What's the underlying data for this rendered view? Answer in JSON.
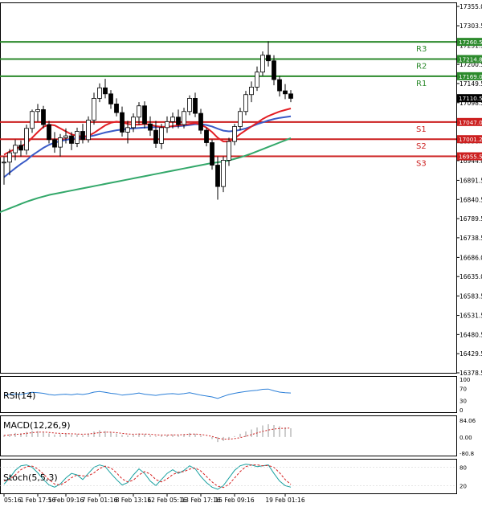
{
  "colors": {
    "bull": "#2e8b2e",
    "bear": "#cc1f1f",
    "ma_fast": "#e31e24",
    "ma_mid": "#3a5bc7",
    "ma_slow": "#33a86a",
    "resistance": "#2c8a2c",
    "support": "#cc1f1f",
    "current_price_bg": "#000000",
    "rsi": "#2b7fd8",
    "macd_signal": "#cc1f1f",
    "macd_hist": "#999999",
    "stoch_k": "#1aa1a1",
    "stoch_d": "#d62020"
  },
  "chart_data": {
    "type": "candlestick",
    "title": "",
    "price_axis": {
      "ticks": [
        "17355.0",
        "17303.5",
        "17251.5",
        "17200.5",
        "17149.5",
        "17098.5",
        "17047.0",
        "16996.0",
        "16944.0",
        "16891.5",
        "16840.5",
        "16789.5",
        "16738.5",
        "16686.0",
        "16635.0",
        "16583.5",
        "16531.5",
        "16480.5",
        "16429.5",
        "16378.5"
      ],
      "ylim": [
        16378.5,
        17355.0
      ]
    },
    "time_axis": {
      "ticks": [
        "05:16",
        "1 Feb 17:16",
        "5 Feb 09:16",
        "7 Feb 01:16",
        "8 Feb 13:16",
        "12 Feb 05:16",
        "13 Feb 17:16",
        "15 Feb 09:16",
        "19 Feb 01:16"
      ]
    },
    "levels": [
      {
        "name": "R3",
        "value": 17260.5,
        "label": "17260.5",
        "kind": "resistance"
      },
      {
        "name": "R2",
        "value": 17214.8,
        "label": "17214.8",
        "kind": "resistance"
      },
      {
        "name": "R1",
        "value": 17169.0,
        "label": "17169.0",
        "kind": "resistance"
      },
      {
        "name": "S1",
        "value": 17047.0,
        "label": "17047.0",
        "kind": "support"
      },
      {
        "name": "S2",
        "value": 17001.2,
        "label": "17001.2",
        "kind": "support"
      },
      {
        "name": "S3",
        "value": 16955.5,
        "label": "16955.5",
        "kind": "support"
      }
    ],
    "current_price": {
      "value": 17110.5,
      "label": "17110.5"
    },
    "candles": [
      [
        16938,
        16955,
        16880,
        16940
      ],
      [
        16940,
        16975,
        16905,
        16965
      ],
      [
        16965,
        17000,
        16945,
        16985
      ],
      [
        16985,
        16998,
        16955,
        16972
      ],
      [
        16972,
        17040,
        16960,
        17030
      ],
      [
        17030,
        17080,
        17018,
        17075
      ],
      [
        17075,
        17095,
        17048,
        17080
      ],
      [
        17080,
        17090,
        17030,
        17040
      ],
      [
        17040,
        17050,
        16990,
        17000
      ],
      [
        17000,
        17020,
        16965,
        16980
      ],
      [
        16980,
        17015,
        16955,
        17005
      ],
      [
        17005,
        17030,
        16990,
        17010
      ],
      [
        17010,
        17020,
        16972,
        16990
      ],
      [
        16990,
        17032,
        16980,
        17022
      ],
      [
        17022,
        17042,
        16990,
        17000
      ],
      [
        17000,
        17062,
        16992,
        17052
      ],
      [
        17052,
        17125,
        17040,
        17110
      ],
      [
        17110,
        17150,
        17100,
        17138
      ],
      [
        17138,
        17162,
        17110,
        17122
      ],
      [
        17122,
        17132,
        17082,
        17095
      ],
      [
        17095,
        17110,
        17062,
        17072
      ],
      [
        17072,
        17088,
        17008,
        17020
      ],
      [
        17020,
        17050,
        16990,
        17032
      ],
      [
        17032,
        17070,
        17020,
        17060
      ],
      [
        17060,
        17100,
        17040,
        17090
      ],
      [
        17090,
        17102,
        17030,
        17042
      ],
      [
        17042,
        17062,
        17010,
        17025
      ],
      [
        17025,
        17050,
        16978,
        16990
      ],
      [
        16990,
        17042,
        16975,
        17032
      ],
      [
        17032,
        17062,
        17018,
        17048
      ],
      [
        17048,
        17072,
        17030,
        17060
      ],
      [
        17060,
        17080,
        17030,
        17040
      ],
      [
        17040,
        17085,
        17030,
        17075
      ],
      [
        17075,
        17118,
        17065,
        17110
      ],
      [
        17110,
        17125,
        17060,
        17070
      ],
      [
        17070,
        17082,
        17015,
        17025
      ],
      [
        17025,
        17032,
        16982,
        16992
      ],
      [
        16992,
        17000,
        16920,
        16932
      ],
      [
        16932,
        16955,
        16840,
        16875
      ],
      [
        16875,
        16955,
        16860,
        16945
      ],
      [
        16945,
        17005,
        16930,
        16995
      ],
      [
        16995,
        17042,
        16985,
        17035
      ],
      [
        17035,
        17085,
        17025,
        17075
      ],
      [
        17075,
        17130,
        17065,
        17120
      ],
      [
        17120,
        17155,
        17100,
        17140
      ],
      [
        17140,
        17195,
        17130,
        17180
      ],
      [
        17180,
        17235,
        17170,
        17225
      ],
      [
        17225,
        17262,
        17195,
        17210
      ],
      [
        17210,
        17225,
        17145,
        17160
      ],
      [
        17160,
        17170,
        17115,
        17130
      ],
      [
        17130,
        17148,
        17108,
        17122
      ],
      [
        17122,
        17132,
        17100,
        17110
      ]
    ],
    "moving_averages": {
      "fast": [
        16960,
        16968,
        16975,
        16982,
        16990,
        17005,
        17020,
        17034,
        17040,
        17038,
        17030,
        17022,
        17014,
        17010,
        17008,
        17010,
        17018,
        17028,
        17038,
        17045,
        17048,
        17046,
        17042,
        17040,
        17040,
        17042,
        17040,
        17036,
        17034,
        17034,
        17036,
        17038,
        17040,
        17042,
        17044,
        17040,
        17032,
        17020,
        17005,
        16995,
        16995,
        17003,
        17015,
        17025,
        17035,
        17045,
        17055,
        17063,
        17069,
        17075,
        17079,
        17083
      ],
      "mid": [
        16900,
        16912,
        16924,
        16935,
        16945,
        16958,
        16968,
        16978,
        16986,
        16992,
        16996,
        16999,
        17002,
        17004,
        17006,
        17008,
        17011,
        17015,
        17019,
        17022,
        17025,
        17027,
        17029,
        17030,
        17031,
        17032,
        17033,
        17033,
        17034,
        17034,
        17035,
        17036,
        17037,
        17039,
        17041,
        17041,
        17039,
        17035,
        17029,
        17024,
        17022,
        17023,
        17026,
        17030,
        17035,
        17041,
        17046,
        17051,
        17055,
        17058,
        17060,
        17062
      ],
      "slow": [
        16805,
        16811,
        16817,
        16823,
        16829,
        16835,
        16840,
        16845,
        16849,
        16853,
        16856,
        16859,
        16862,
        16865,
        16868,
        16871,
        16874,
        16877,
        16880,
        16883,
        16886,
        16889,
        16892,
        16895,
        16898,
        16901,
        16904,
        16907,
        16910,
        16913,
        16916,
        16919,
        16922,
        16925,
        16928,
        16931,
        16934,
        16937,
        16939,
        16941,
        16944,
        16948,
        16952,
        16957,
        16962,
        16968,
        16974,
        16980,
        16986,
        16992,
        16998,
        17004
      ]
    },
    "indicators": {
      "rsi": {
        "label": "RSI(14)",
        "ticks": [
          "100",
          "70",
          "30",
          "0"
        ],
        "values": [
          48,
          50,
          52,
          50,
          54,
          57,
          56,
          54,
          50,
          48,
          50,
          51,
          49,
          52,
          50,
          53,
          58,
          60,
          57,
          54,
          52,
          48,
          50,
          52,
          55,
          51,
          49,
          47,
          50,
          52,
          53,
          51,
          53,
          56,
          52,
          48,
          45,
          42,
          37,
          44,
          50,
          54,
          57,
          60,
          62,
          64,
          67,
          68,
          62,
          58,
          56,
          55
        ]
      },
      "macd": {
        "label": "MACD(12,26,9)",
        "ticks": [
          "84.06",
          "0.00",
          "-80.8"
        ],
        "histogram": [
          10,
          15,
          20,
          18,
          26,
          32,
          30,
          26,
          18,
          12,
          14,
          16,
          12,
          14,
          10,
          18,
          28,
          34,
          30,
          24,
          18,
          10,
          8,
          12,
          18,
          14,
          10,
          4,
          8,
          10,
          12,
          10,
          14,
          20,
          16,
          8,
          0,
          -10,
          -25,
          -20,
          -10,
          4,
          16,
          28,
          38,
          48,
          58,
          64,
          60,
          54,
          48,
          44
        ],
        "signal": [
          8,
          10,
          13,
          15,
          18,
          22,
          24,
          25,
          23,
          20,
          18,
          17,
          16,
          15,
          14,
          15,
          18,
          22,
          24,
          24,
          22,
          18,
          15,
          14,
          15,
          15,
          14,
          11,
          10,
          10,
          11,
          11,
          12,
          14,
          15,
          13,
          9,
          3,
          -6,
          -10,
          -11,
          -8,
          -3,
          4,
          12,
          20,
          28,
          35,
          40,
          43,
          44,
          45
        ]
      },
      "stoch": {
        "label": "Stoch(5,5,3)",
        "ticks": [
          "80",
          "20"
        ],
        "k": [
          25,
          45,
          70,
          85,
          88,
          80,
          62,
          40,
          22,
          15,
          25,
          45,
          60,
          55,
          40,
          60,
          80,
          88,
          82,
          60,
          40,
          22,
          30,
          55,
          75,
          60,
          35,
          20,
          40,
          60,
          72,
          60,
          70,
          85,
          75,
          50,
          30,
          15,
          8,
          20,
          45,
          70,
          85,
          90,
          88,
          82,
          85,
          88,
          60,
          35,
          20,
          15
        ],
        "d": [
          35,
          40,
          55,
          72,
          82,
          84,
          75,
          58,
          40,
          25,
          22,
          32,
          46,
          55,
          52,
          52,
          62,
          76,
          84,
          78,
          62,
          42,
          32,
          38,
          55,
          66,
          58,
          40,
          32,
          42,
          56,
          64,
          66,
          74,
          78,
          68,
          50,
          32,
          18,
          14,
          24,
          45,
          66,
          82,
          88,
          88,
          85,
          86,
          80,
          62,
          40,
          24
        ]
      }
    }
  }
}
